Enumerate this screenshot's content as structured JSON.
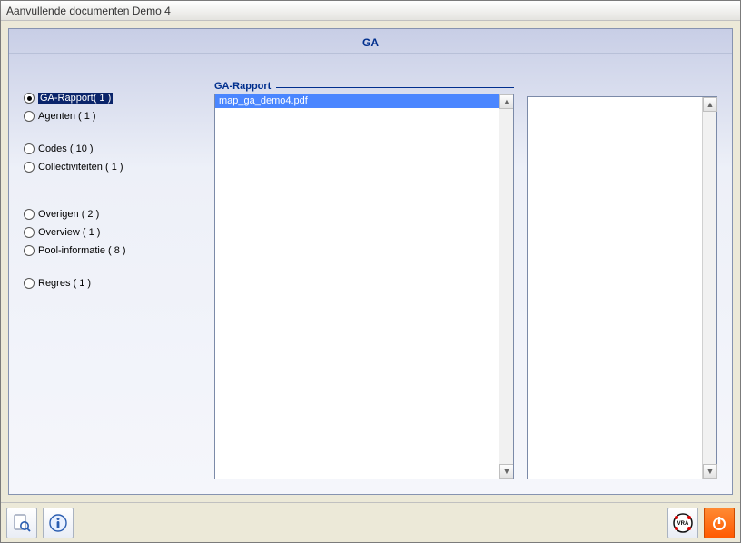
{
  "window": {
    "title": "Aanvullende documenten Demo 4"
  },
  "header": {
    "title": "GA"
  },
  "categories": [
    {
      "label": "GA-Rapport( 1 )",
      "selected": true
    },
    {
      "label": "Agenten ( 1 )",
      "selected": false
    },
    {
      "gap": true
    },
    {
      "label": "Codes ( 10 )",
      "selected": false
    },
    {
      "label": "Collectiviteiten ( 1 )",
      "selected": false
    },
    {
      "gap": true
    },
    {
      "gap": true
    },
    {
      "label": "Overigen ( 2 )",
      "selected": false
    },
    {
      "label": "Overview ( 1 )",
      "selected": false
    },
    {
      "label": "Pool-informatie ( 8 )",
      "selected": false
    },
    {
      "gap": true
    },
    {
      "label": "Regres ( 1 )",
      "selected": false
    }
  ],
  "filelist": {
    "group_label": "GA-Rapport",
    "items": [
      {
        "name": "map_ga_demo4.pdf",
        "selected": true
      }
    ]
  },
  "icons": {
    "preview_tool": "document-magnify",
    "info_tool": "info",
    "vra_tool": "VRA",
    "close_tool": "power"
  }
}
